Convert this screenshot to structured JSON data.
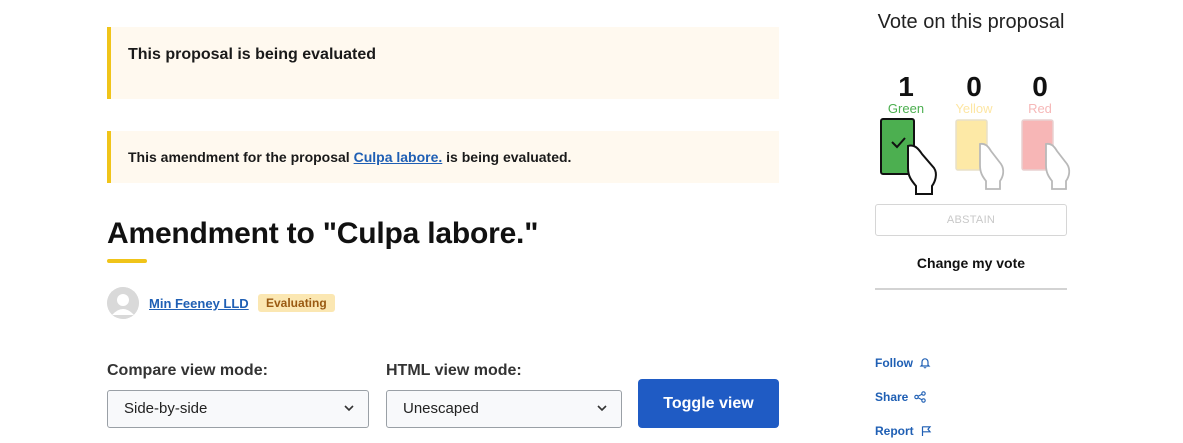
{
  "callouts": {
    "proposal_status": "This proposal is being evaluated",
    "amendment_prefix": "This amendment for the proposal ",
    "amendment_link": "Culpa labore.",
    "amendment_suffix": " is being evaluated."
  },
  "page_title": "Amendment to \"Culpa labore.\"",
  "author": {
    "name": "Min Feeney LLD"
  },
  "status_badge": "Evaluating",
  "compare_view": {
    "label": "Compare view mode:",
    "value": "Side-by-side"
  },
  "html_view": {
    "label": "HTML view mode:",
    "value": "Unescaped"
  },
  "toggle_button": "Toggle view",
  "vote": {
    "title": "Vote on this proposal",
    "options": [
      {
        "count": "1",
        "label": "Green",
        "color": "#4caf50",
        "selected": true
      },
      {
        "count": "0",
        "label": "Yellow",
        "color": "#fde9a6",
        "selected": false
      },
      {
        "count": "0",
        "label": "Red",
        "color": "#f7b6b6",
        "selected": false
      }
    ],
    "abstain": "ABSTAIN",
    "change": "Change my vote"
  },
  "actions": {
    "follow": "Follow",
    "share": "Share",
    "report": "Report"
  },
  "colors": {
    "accent_yellow": "#f0c419",
    "link_blue": "#1f5fb4",
    "button_blue": "#1f5bc4"
  }
}
